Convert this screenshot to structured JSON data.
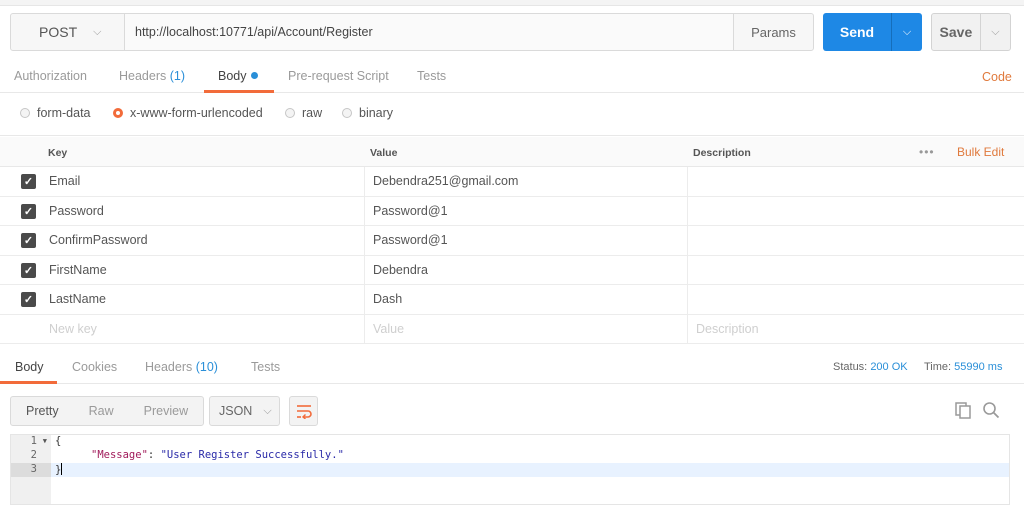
{
  "request": {
    "method": "POST",
    "url": "http://localhost:10771/api/Account/Register",
    "params_label": "Params",
    "send_label": "Send",
    "save_label": "Save"
  },
  "request_tabs": {
    "authorization": "Authorization",
    "headers": "Headers",
    "headers_count": "(1)",
    "body": "Body",
    "prerequest": "Pre-request Script",
    "tests": "Tests",
    "code": "Code"
  },
  "body_types": {
    "form_data": "form-data",
    "urlencoded": "x-www-form-urlencoded",
    "raw": "raw",
    "binary": "binary",
    "selected": "x-www-form-urlencoded"
  },
  "kv_table": {
    "header_key": "Key",
    "header_value": "Value",
    "header_description": "Description",
    "more": "•••",
    "bulk_edit": "Bulk Edit",
    "rows": [
      {
        "key": "Email",
        "value": "Debendra251@gmail.com",
        "checked": true
      },
      {
        "key": "Password",
        "value": "Password@1",
        "checked": true
      },
      {
        "key": "ConfirmPassword",
        "value": "Password@1",
        "checked": true
      },
      {
        "key": "FirstName",
        "value": "Debendra",
        "checked": true
      },
      {
        "key": "LastName",
        "value": "Dash",
        "checked": true
      }
    ],
    "new_key_placeholder": "New key",
    "value_placeholder": "Value",
    "description_placeholder": "Description"
  },
  "response": {
    "tabs": {
      "body": "Body",
      "cookies": "Cookies",
      "headers": "Headers",
      "headers_count": "(10)",
      "tests": "Tests"
    },
    "status_label": "Status:",
    "status_value": "200 OK",
    "time_label": "Time:",
    "time_value": "55990 ms",
    "view_modes": {
      "pretty": "Pretty",
      "raw": "Raw",
      "preview": "Preview"
    },
    "format": "JSON",
    "code_lines": {
      "l1": "{",
      "l2_key": "\"Message\"",
      "l2_sep": ": ",
      "l2_val": "\"User Register Successfully.\"",
      "l3": "}"
    },
    "line_numbers": [
      "1",
      "2",
      "3"
    ]
  },
  "colors": {
    "send": "#1e88e5",
    "accent": "#f26b3a",
    "link_blue": "#2a8fd8",
    "code_orange": "#e07a3d"
  }
}
